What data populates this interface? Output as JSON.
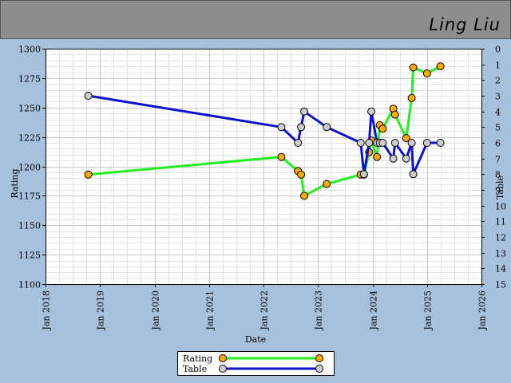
{
  "header": {
    "player_name": "Ling Liu"
  },
  "chart_data": {
    "type": "line",
    "title": "",
    "xlabel": "Date",
    "ylabel_left": "Rating",
    "ylabel_right": "Table",
    "x_range": [
      "2018-01-01",
      "2026-01-01"
    ],
    "x_ticks": [
      "Jan 2018",
      "Jan 2019",
      "Jan 2020",
      "Jan 2021",
      "Jan 2022",
      "Jan 2023",
      "Jan 2024",
      "Jan 2025",
      "Jan 2026"
    ],
    "y_left": {
      "min": 1100,
      "max": 1300,
      "ticks": [
        1100,
        1125,
        1150,
        1175,
        1200,
        1225,
        1250,
        1275,
        1300
      ]
    },
    "y_right": {
      "min": 0,
      "max": 15,
      "inverted": true,
      "ticks": [
        0,
        1,
        2,
        3,
        4,
        5,
        6,
        7,
        8,
        9,
        10,
        11,
        12,
        13,
        14,
        15
      ]
    },
    "grid": true,
    "legend_position": "bottom-center",
    "series": [
      {
        "name": "Rating",
        "axis": "left",
        "line_color": "#22ee22",
        "marker_color": "#ffaa00",
        "points": [
          [
            "2018-10-15",
            1193
          ],
          [
            "2022-05-01",
            1208
          ],
          [
            "2022-08-20",
            1196
          ],
          [
            "2022-09-10",
            1193
          ],
          [
            "2022-10-01",
            1175
          ],
          [
            "2023-03-01",
            1185
          ],
          [
            "2023-10-15",
            1193
          ],
          [
            "2023-11-05",
            1193
          ],
          [
            "2023-12-10",
            1212
          ],
          [
            "2023-12-25",
            1222
          ],
          [
            "2024-02-01",
            1208
          ],
          [
            "2024-02-20",
            1235
          ],
          [
            "2024-03-10",
            1232
          ],
          [
            "2024-05-20",
            1249
          ],
          [
            "2024-06-01",
            1244
          ],
          [
            "2024-08-15",
            1224
          ],
          [
            "2024-09-20",
            1258
          ],
          [
            "2024-10-01",
            1284
          ],
          [
            "2025-01-01",
            1279
          ],
          [
            "2025-04-01",
            1285
          ]
        ]
      },
      {
        "name": "Table",
        "axis": "right",
        "line_color": "#1111cc",
        "marker_color": "#cccccc",
        "points": [
          [
            "2018-10-15",
            3
          ],
          [
            "2022-05-01",
            5
          ],
          [
            "2022-08-20",
            6
          ],
          [
            "2022-09-10",
            5
          ],
          [
            "2022-10-01",
            4
          ],
          [
            "2023-03-01",
            5
          ],
          [
            "2023-10-15",
            6
          ],
          [
            "2023-11-05",
            8
          ],
          [
            "2023-12-10",
            6
          ],
          [
            "2023-12-25",
            4
          ],
          [
            "2024-02-01",
            6
          ],
          [
            "2024-02-20",
            6
          ],
          [
            "2024-03-10",
            6
          ],
          [
            "2024-05-20",
            7
          ],
          [
            "2024-06-01",
            6
          ],
          [
            "2024-08-15",
            7
          ],
          [
            "2024-09-20",
            6
          ],
          [
            "2024-10-01",
            8
          ],
          [
            "2025-01-01",
            6
          ],
          [
            "2025-04-01",
            6
          ]
        ]
      }
    ]
  }
}
